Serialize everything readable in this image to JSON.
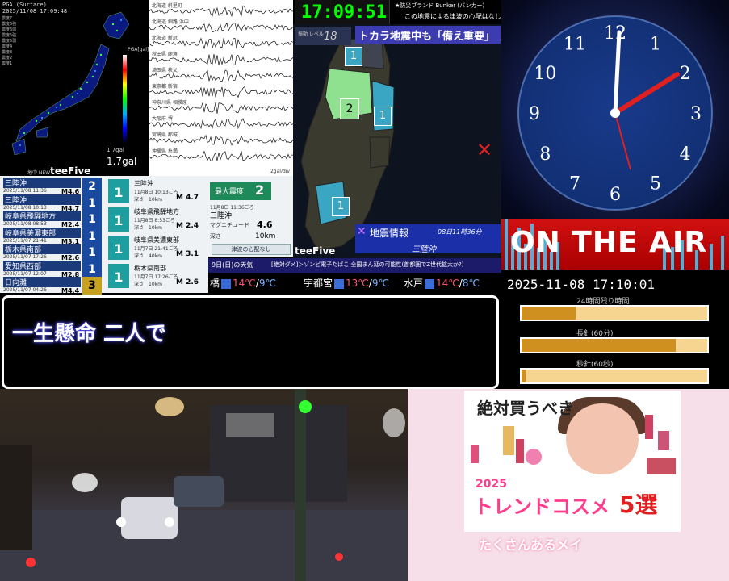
{
  "pga_panel": {
    "title": "PGA (Surface)",
    "timestamp": "2025/11/08 17:09:48",
    "legend_unit": "PGA[gal]",
    "max_value_small": "1.7gal",
    "max_value": "1.7gal",
    "station_list": [
      "震度7",
      "震度6強",
      "震度6弱",
      "震度5強",
      "震度5弱",
      "震度4",
      "震度3",
      "震度2",
      "震度1"
    ],
    "brand_small": "地中 NEW",
    "brand": "teeFive"
  },
  "waveforms": {
    "stations": [
      "北海道 斜里町",
      "北海道 釧路 浜中",
      "北海道 新冠",
      "秋田県 鹿角",
      "埼玉県 秩父",
      "東京都 新宿",
      "神奈川県 相模原",
      "大阪府 堺",
      "宮崎県 都城",
      "沖縄県 糸満"
    ],
    "footer": "2gal/div"
  },
  "clock_header": {
    "time": "17:09:51"
  },
  "bunker": {
    "line1": "★防災ブランド Bunker (バンカー)",
    "line2": "この地震による津波の心配はなし"
  },
  "shindo_map": {
    "level_label": "振動 レベル",
    "level_value": "18",
    "banner": "トカラ地震中も「備え重要」",
    "badges": [
      "1",
      "2",
      "1",
      "1",
      "1"
    ],
    "info_title": "地震情報",
    "info_time": "08日11時36分",
    "info_place": "三陸沖",
    "brand": "teeFive",
    "xmark": "✕"
  },
  "eq_list": [
    {
      "place": "三陸沖",
      "date": "2025/11/08 11:36",
      "mag": "M4.6",
      "shindo": "2"
    },
    {
      "place": "三陸沖",
      "date": "2025/11/08 10:13",
      "mag": "M4.7",
      "shindo": "1"
    },
    {
      "place": "岐阜県飛騨地方",
      "date": "2025/11/08 08:53",
      "mag": "M2.4",
      "shindo": "1"
    },
    {
      "place": "岐阜県美濃東部",
      "date": "2025/11/07 21:41",
      "mag": "M3.1",
      "shindo": "1"
    },
    {
      "place": "栃木県南部",
      "date": "2025/11/07 17:26",
      "mag": "M2.6",
      "shindo": "1"
    },
    {
      "place": "愛知県西部",
      "date": "2025/11/07 12:07",
      "mag": "M2.8",
      "shindo": "1"
    },
    {
      "place": "日向灘",
      "date": "2025/11/07 04:26",
      "mag": "M4.4",
      "shindo": "3"
    }
  ],
  "eq_detail": [
    {
      "badge": "1",
      "name": "三陸沖",
      "time": "11月8日 10:13ごろ",
      "depth": "深さ　10km",
      "mag": "M 4.7"
    },
    {
      "badge": "1",
      "name": "岐阜県飛騨地方",
      "time": "11月8日 8:53ごろ",
      "depth": "深さ　10km",
      "mag": "M 2.4"
    },
    {
      "badge": "1",
      "name": "岐阜県美濃東部",
      "time": "11月7日 21:41ごろ",
      "depth": "深さ　40km",
      "mag": "M 3.1"
    },
    {
      "badge": "1",
      "name": "栃木県南部",
      "time": "11月7日 17:26ごろ",
      "depth": "深さ　10km",
      "mag": "M 2.6"
    }
  ],
  "max_intensity": {
    "label": "最大震度",
    "value": "2",
    "time": "11月8日 11:36ごろ",
    "place": "三陸沖",
    "mag_label": "マグニチュード",
    "mag_value": "4.6",
    "depth_label": "深さ",
    "depth_value": "10km",
    "tsunami": "津波の心配なし"
  },
  "weather": {
    "header": "9日(日)の天気",
    "news": "[絶対ダメ]＞ゾンビ電子たばこ 全国まん延の可能性(首都圏でZ世代拡大か?)",
    "cities": [
      {
        "name": "橋",
        "hi": "14℃",
        "lo": "9℃"
      },
      {
        "name": "宇都宮",
        "hi": "13℃",
        "lo": "9℃"
      },
      {
        "name": "水戸",
        "hi": "14℃",
        "lo": "8℃"
      }
    ]
  },
  "caption": {
    "text": "一生懸命 二人で"
  },
  "clock": {
    "numbers": [
      "12",
      "1",
      "2",
      "3",
      "4",
      "5",
      "6",
      "7",
      "8",
      "9",
      "10",
      "11"
    ],
    "on_air": "ON THE AIR",
    "datetime": "2025-11-08 17:10:01",
    "bars": [
      {
        "label": "24時間残り時間",
        "progress": 0.29
      },
      {
        "label": "長針(60分)",
        "progress": 0.83
      },
      {
        "label": "秒針(60秒)",
        "progress": 0.02
      }
    ]
  },
  "ad": {
    "headline": "絶対買うべき",
    "year": "2025",
    "subtitle": "トレンドコスメ",
    "count": "5選",
    "footer": "たくさんあるメイ"
  }
}
